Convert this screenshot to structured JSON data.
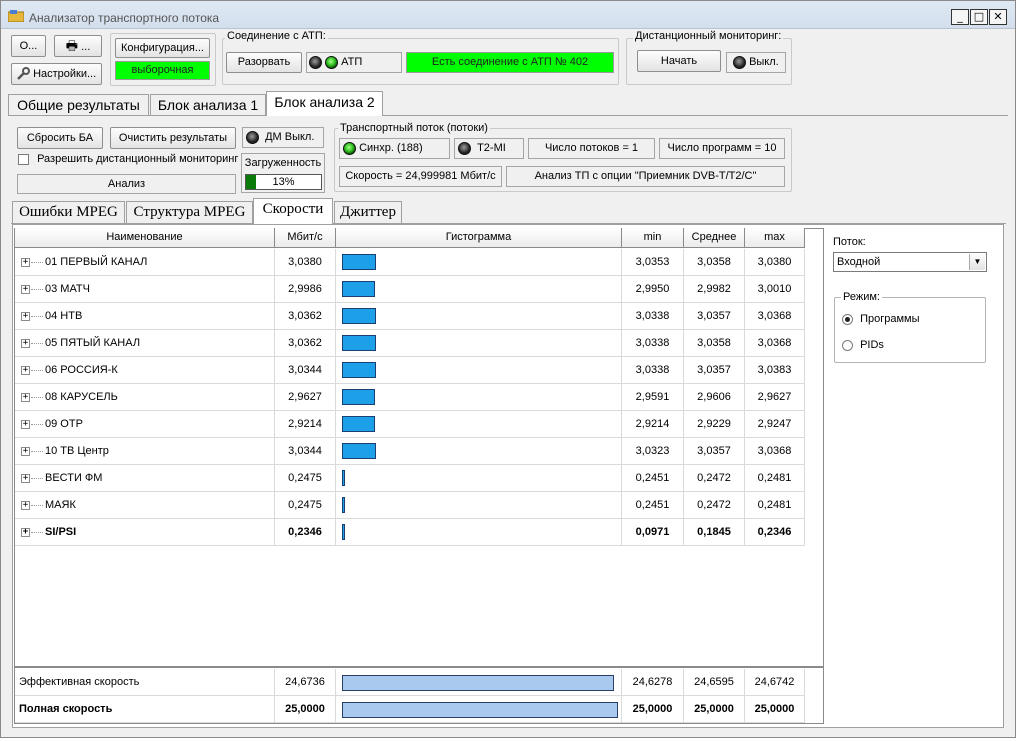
{
  "window": {
    "title": "Анализатор транспортного потока"
  },
  "toolbar": {
    "open_label": "О...",
    "print_label": "...",
    "settings_label": "Настройки...",
    "config_label": "Конфигурация...",
    "config_status": "выборочная"
  },
  "atp": {
    "legend": "Соединение с АТП:",
    "disconnect_label": "Разорвать",
    "atp_label": "АТП",
    "status": "Есть соединение с АТП № 402"
  },
  "remote": {
    "legend": "Дистанционный мониторинг:",
    "start_label": "Начать",
    "off_label": "Выкл."
  },
  "main_tabs": [
    "Общие результаты",
    "Блок анализа 1",
    "Блок анализа 2"
  ],
  "controls": {
    "reset_label": "Сбросить БА",
    "clear_label": "Очистить результаты",
    "dm_label": "ДМ Выкл.",
    "allow_remote_label": "Разрешить дистанционный мониторинг",
    "analysis_label": "Анализ",
    "load_label": "Загруженность",
    "load_value": "13%",
    "load_fraction": 0.13
  },
  "stream": {
    "legend": "Транспортный поток (потоки)",
    "sync_label": "Синхр. (188)",
    "t2mi_label": "T2-MI",
    "streams_count": "Число потоков = 1",
    "programs_count": "Число программ = 10",
    "speed": "Скорость = 24,999981 Мбит/с",
    "option": "Анализ ТП с опции \"Приемник DVB-T/T2/C\""
  },
  "sub_tabs": [
    "Ошибки MPEG",
    "Структура MPEG",
    "Скорости",
    "Джиттер"
  ],
  "table": {
    "headers": [
      "Наименование",
      "Мбит/с",
      "Гистограмма",
      "min",
      "Среднее",
      "max"
    ],
    "rows": [
      {
        "name": "01 ПЕРВЫЙ КАНАЛ",
        "rate": "3,0380",
        "min": "3,0353",
        "avg": "3,0358",
        "max": "3,0380",
        "value": 3.038
      },
      {
        "name": "03 МАТЧ",
        "rate": "2,9986",
        "min": "2,9950",
        "avg": "2,9982",
        "max": "3,0010",
        "value": 2.9986
      },
      {
        "name": "04 НТВ",
        "rate": "3,0362",
        "min": "3,0338",
        "avg": "3,0357",
        "max": "3,0368",
        "value": 3.0362
      },
      {
        "name": "05 ПЯТЫЙ КАНАЛ",
        "rate": "3,0362",
        "min": "3,0338",
        "avg": "3,0358",
        "max": "3,0368",
        "value": 3.0362
      },
      {
        "name": "06 РОССИЯ-К",
        "rate": "3,0344",
        "min": "3,0338",
        "avg": "3,0357",
        "max": "3,0383",
        "value": 3.0344
      },
      {
        "name": "08 КАРУСЕЛЬ",
        "rate": "2,9627",
        "min": "2,9591",
        "avg": "2,9606",
        "max": "2,9627",
        "value": 2.9627
      },
      {
        "name": "09 ОТР",
        "rate": "2,9214",
        "min": "2,9214",
        "avg": "2,9229",
        "max": "2,9247",
        "value": 2.9214
      },
      {
        "name": "10 ТВ Центр",
        "rate": "3,0344",
        "min": "3,0323",
        "avg": "3,0357",
        "max": "3,0368",
        "value": 3.0344
      },
      {
        "name": "ВЕСТИ ФМ",
        "rate": "0,2475",
        "min": "0,2451",
        "avg": "0,2472",
        "max": "0,2481",
        "value": 0.2475
      },
      {
        "name": "МАЯК",
        "rate": "0,2475",
        "min": "0,2451",
        "avg": "0,2472",
        "max": "0,2481",
        "value": 0.2475
      },
      {
        "name": "SI/PSI",
        "rate": "0,2346",
        "min": "0,0971",
        "avg": "0,1845",
        "max": "0,2346",
        "value": 0.2346,
        "bold": true
      }
    ],
    "footer": [
      {
        "name": "Эффективная скорость",
        "rate": "24,6736",
        "min": "24,6278",
        "avg": "24,6595",
        "max": "24,6742",
        "value": 24.6736
      },
      {
        "name": "Полная скорость",
        "rate": "25,0000",
        "min": "25,0000",
        "avg": "25,0000",
        "max": "25,0000",
        "value": 25.0,
        "bold": true
      }
    ]
  },
  "side": {
    "stream_label": "Поток:",
    "stream_value": "Входной",
    "mode_legend": "Режим:",
    "mode_programs": "Программы",
    "mode_pids": "PIDs"
  }
}
